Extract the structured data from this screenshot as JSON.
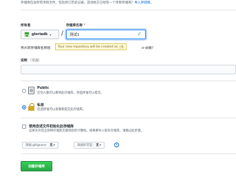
{
  "intro": {
    "text": "存储库包含所有项目文件，包括修订历史记录。其他地方已经有一个项目存储库？",
    "import_link": "导入存储库。"
  },
  "owner": {
    "label": "所有者",
    "name": "gloriadk",
    "caret": "▾"
  },
  "repo": {
    "label": "存储库名称",
    "required_mark": "*",
    "value": "测试1",
    "separator": "/"
  },
  "hint": {
    "text_before": "伟大的存储库名称短",
    "tooltip_before": "Your new repository will be created as",
    "tooltip_code": "-1",
    "text_after": "o-米摘？"
  },
  "description": {
    "label": "说明",
    "optional": "（可选）",
    "value": ""
  },
  "visibility": {
    "public": {
      "title": "Public",
      "desc": "任何人都可以看到此存储库。你选择谁可以提交。",
      "selected": false
    },
    "private": {
      "title": "私有",
      "desc": "您选择谁可以查看和提交此存储库。",
      "selected": true
    }
  },
  "init": {
    "title": "使用自述文件初始化此存储库",
    "desc": "这将允许您立即将存储库克隆到您的计算机。如果要导入现有存储库，请跳过此步骤。",
    "checked": false
  },
  "gitignore": {
    "prefix": "添加.gitignore：",
    "value": "无",
    "caret": "▾"
  },
  "license": {
    "prefix": "添加许可证：",
    "value": "无",
    "caret": "▾"
  },
  "info_icon": "i",
  "create_button": "创建存储库",
  "colors": {
    "link": "#0366d6",
    "primary_green": "#28a745",
    "tooltip_bg": "#fffbdd"
  }
}
